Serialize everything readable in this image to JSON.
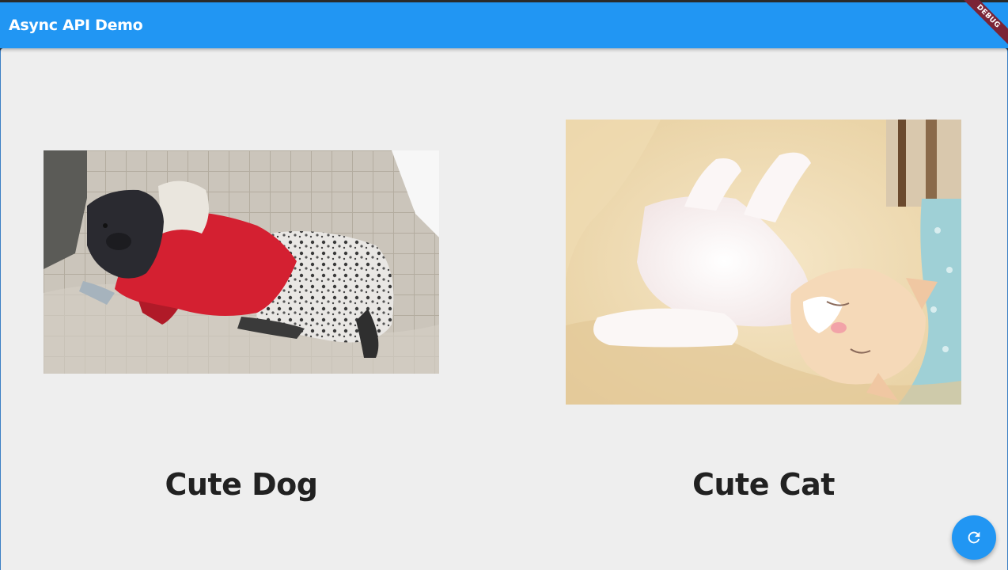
{
  "app": {
    "title": "Async API Demo",
    "debug_banner": "DEBUG"
  },
  "pets": [
    {
      "caption": "Cute Dog",
      "image": "dog-photo"
    },
    {
      "caption": "Cute Cat",
      "image": "cat-photo"
    }
  ],
  "fab": {
    "icon": "refresh-icon"
  },
  "colors": {
    "primary": "#2196f3",
    "background": "#eeeeee",
    "caption_text": "#212121",
    "debug_banner": "#7b2436"
  }
}
